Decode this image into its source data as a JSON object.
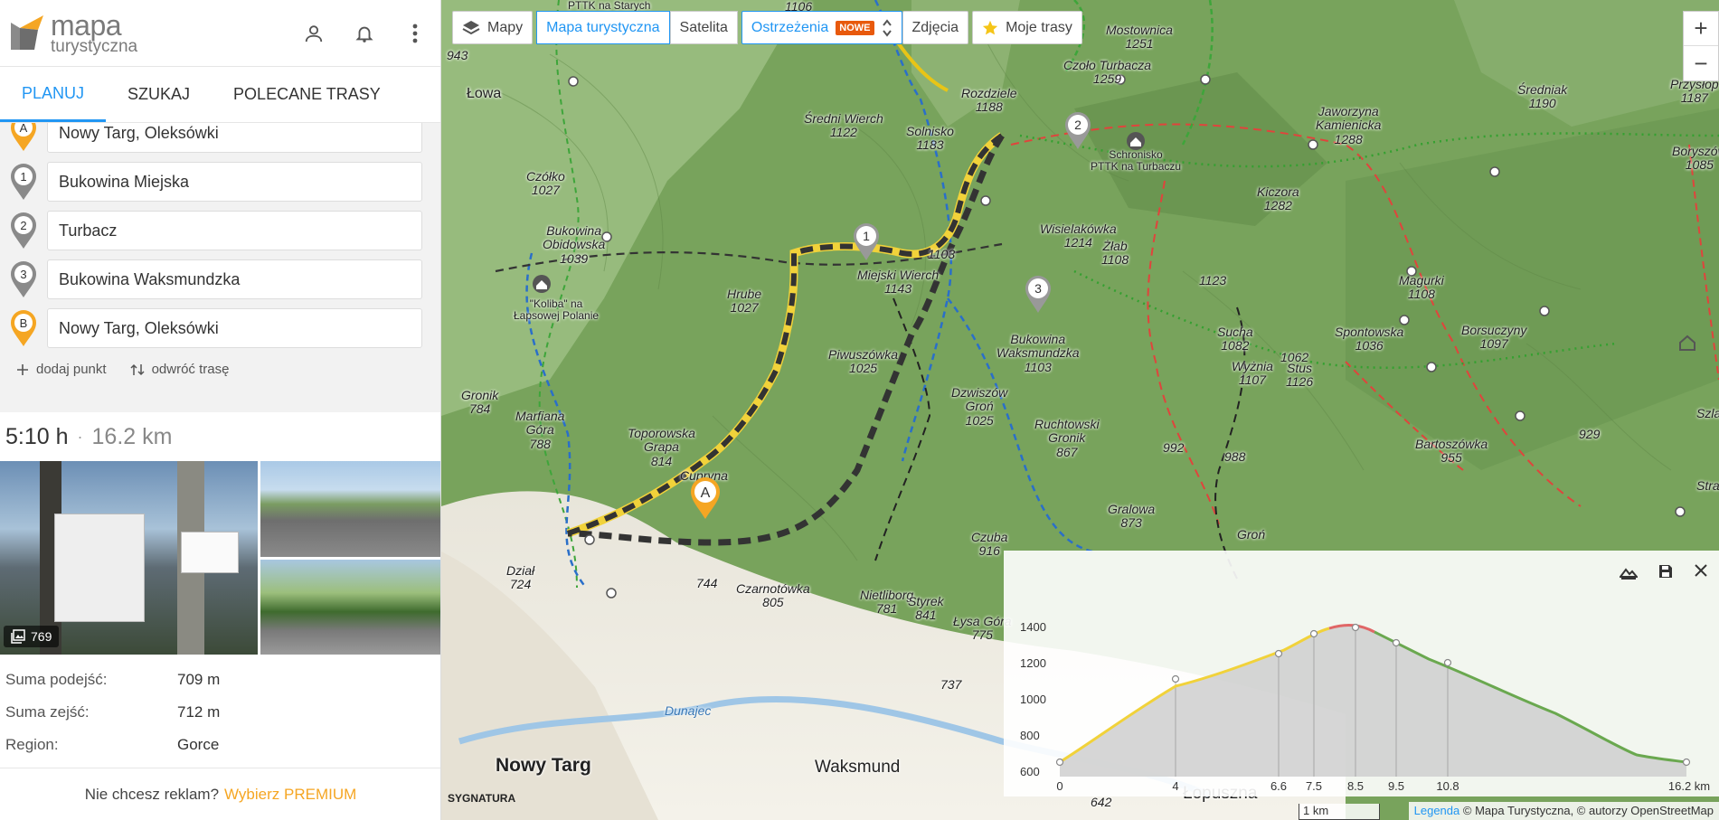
{
  "app": {
    "logo_line1": "mapa",
    "logo_line2": "turystyczna"
  },
  "tabs": [
    {
      "label": "PLANUJ"
    },
    {
      "label": "SZUKAJ"
    },
    {
      "label": "POLECANE TRASY"
    }
  ],
  "waypoints": [
    {
      "marker": "A",
      "value": "Nowy Targ, Oleksówki"
    },
    {
      "marker": "1",
      "value": "Bukowina Miejska"
    },
    {
      "marker": "2",
      "value": "Turbacz"
    },
    {
      "marker": "3",
      "value": "Bukowina Waksmundzka"
    },
    {
      "marker": "B",
      "value": "Nowy Targ, Oleksówki"
    }
  ],
  "actions": {
    "add_point": "dodaj punkt",
    "reverse": "odwróć trasę"
  },
  "summary": {
    "time": "5:10 h",
    "sep": "·",
    "distance": "16.2 km"
  },
  "photos": {
    "count": "769"
  },
  "stats": [
    {
      "label": "Suma podejść:",
      "value": "709 m"
    },
    {
      "label": "Suma zejść:",
      "value": "712 m"
    },
    {
      "label": "Region:",
      "value": "Gorce"
    }
  ],
  "premium": {
    "text": "Nie chcesz reklam?",
    "link": "Wybierz PREMIUM"
  },
  "map_toolbar": {
    "maps": "Mapy",
    "tourist_map": "Mapa turystyczna",
    "satellite": "Satelita",
    "warnings": "Ostrzeżenia",
    "new_badge": "NOWE",
    "photos": "Zdjęcia",
    "my_routes": "Moje trasy"
  },
  "map_labels": [
    {
      "t": "Mostownica\n1251"
    },
    {
      "t": "Czoło Turbacza\n1259"
    },
    {
      "t": "Rozdziele\n1188"
    },
    {
      "t": "Średni Wierch\n1122"
    },
    {
      "t": "Solnisko\n1183"
    },
    {
      "t": "Jaworzyna\nKamienicka\n1288"
    },
    {
      "t": "Średniak\n1190"
    },
    {
      "t": "Schronisko\nPTTK na Turbaczu"
    },
    {
      "t": "Czółko\n1027"
    },
    {
      "t": "Bukowina\nObidowska\n1039"
    },
    {
      "t": "Wisielakówka\n1214"
    },
    {
      "t": "Żłab\n1108"
    },
    {
      "t": "Kiczora\n1282"
    },
    {
      "t": "1103"
    },
    {
      "t": "Miejski Wierch\n1143"
    },
    {
      "t": "\"Koliba\" na\nŁapsowej Polanie"
    },
    {
      "t": "Hrube\n1027"
    },
    {
      "t": "1123"
    },
    {
      "t": "Magurki\n1108"
    },
    {
      "t": "Sucha\n1082"
    },
    {
      "t": "1062"
    },
    {
      "t": "Spontowska\n1036"
    },
    {
      "t": "Borsuczyny\n1097"
    },
    {
      "t": "Piwuszówka\n1025"
    },
    {
      "t": "Bukowina\nWaksmundzka\n1103"
    },
    {
      "t": "Wyżnia\n1107"
    },
    {
      "t": "Stus\n1126"
    },
    {
      "t": "Gronik\n784"
    },
    {
      "t": "Marfiana\nGóra\n788"
    },
    {
      "t": "Toporowska\nGrapa\n814"
    },
    {
      "t": "Dzwiszów\nGroń\n1025"
    },
    {
      "t": "Ruchtowski\nGronik\n867"
    },
    {
      "t": "992"
    },
    {
      "t": "988"
    },
    {
      "t": "Bartoszówka\n955"
    },
    {
      "t": "929"
    },
    {
      "t": "Cupryna\n857"
    },
    {
      "t": "Gralowa\n873"
    },
    {
      "t": "Groń"
    },
    {
      "t": "Czuba\n916"
    },
    {
      "t": "Dział\n724"
    },
    {
      "t": "744"
    },
    {
      "t": "Czarnotówka\n805"
    },
    {
      "t": "Nietliborg\n781"
    },
    {
      "t": "Styrek\n841"
    },
    {
      "t": "Łysa Góra\n775"
    },
    {
      "t": "737"
    },
    {
      "t": "Dunajec"
    },
    {
      "t": "Nowy Targ"
    },
    {
      "t": "Waksmund"
    },
    {
      "t": "Łopuszna"
    },
    {
      "t": "Przysłop\n1187"
    },
    {
      "t": "Boryszów\n1085"
    },
    {
      "t": "943"
    },
    {
      "t": "Łowa"
    },
    {
      "t": "PTTK na Starych"
    },
    {
      "t": "1106"
    },
    {
      "t": "642"
    },
    {
      "t": "Szla"
    },
    {
      "t": "Stra"
    }
  ],
  "markers": [
    {
      "label": "A"
    },
    {
      "label": "1"
    },
    {
      "label": "2"
    },
    {
      "label": "3"
    }
  ],
  "elevation": {
    "y_ticks": [
      "1400",
      "1200",
      "1000",
      "800",
      "600"
    ],
    "x_ticks": [
      "0",
      "4",
      "6.6",
      "7.5",
      "8.5",
      "9.5",
      "10.8",
      "16.2 km"
    ]
  },
  "scale": "1 km",
  "attribution": {
    "legend": "Legenda",
    "text": "© Mapa Turystyczna, © autorzy OpenStreetMap"
  },
  "watermark": "SYGNATURA",
  "colors": {
    "accent": "#2196f3",
    "orange": "#f5a623",
    "route": "#333333",
    "easy": "#6aa84f",
    "medium": "#f1d23a",
    "hard": "#e06666"
  }
}
